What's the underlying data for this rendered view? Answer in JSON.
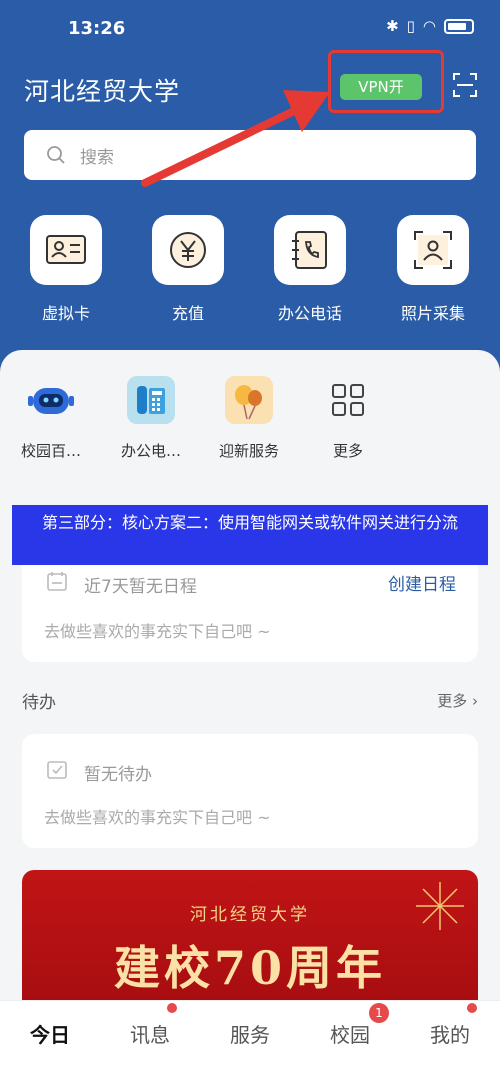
{
  "status": {
    "time": "13:26"
  },
  "header": {
    "title": "河北经贸大学",
    "vpn_label": "VPN开"
  },
  "search": {
    "placeholder": "搜索"
  },
  "quick_actions": [
    {
      "label": "虚拟卡",
      "icon": "virtual-card-icon"
    },
    {
      "label": "充值",
      "icon": "yuan-icon"
    },
    {
      "label": "办公电话",
      "icon": "office-phone-icon"
    },
    {
      "label": "照片采集",
      "icon": "photo-capture-icon"
    }
  ],
  "services": [
    {
      "label": "校园百…",
      "icon": "robot-icon"
    },
    {
      "label": "办公电…",
      "icon": "desk-phone-icon"
    },
    {
      "label": "迎新服务",
      "icon": "balloons-icon"
    },
    {
      "label": "更多",
      "icon": "grid-icon"
    }
  ],
  "banner": {
    "text": "第三部分：核心方案二：使用智能网关或软件网关进行分流"
  },
  "schedule": {
    "title": "近7天暂无日程",
    "action": "创建日程",
    "subtitle": "去做些喜欢的事充实下自己吧 ~"
  },
  "todo": {
    "section_title": "待办",
    "more": "更多",
    "title": "暂无待办",
    "subtitle": "去做些喜欢的事充实下自己吧 ~"
  },
  "anniversary": {
    "school": "河北经贸大学",
    "headline": "建校70周年"
  },
  "tabs": [
    {
      "label": "今日",
      "active": true
    },
    {
      "label": "讯息",
      "dot": true
    },
    {
      "label": "服务"
    },
    {
      "label": "校园",
      "badge": "1"
    },
    {
      "label": "我的",
      "dot": true
    }
  ],
  "colors": {
    "header": "#2a5ca8",
    "vpn": "#5cc46a",
    "highlight": "#e53a33",
    "banner": "#2a37e8"
  }
}
